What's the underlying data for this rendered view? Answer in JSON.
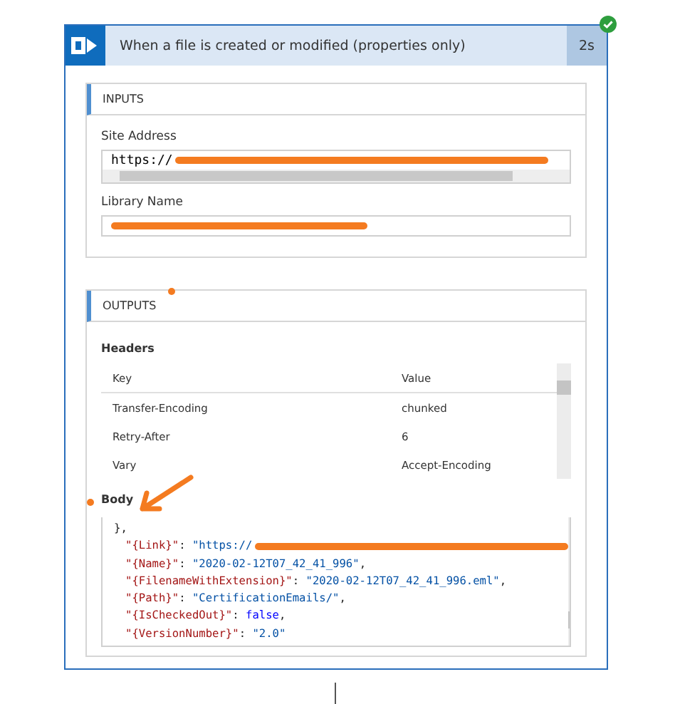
{
  "card": {
    "title": "When a file is created or modified (properties only)",
    "duration": "2s",
    "succeeded": true
  },
  "inputs": {
    "title": "INPUTS",
    "fields": [
      {
        "label": "Site Address",
        "value": "https://",
        "redacted": true,
        "scrollbar": true
      },
      {
        "label": "Library Name",
        "redacted": true,
        "scrollbar": false
      }
    ]
  },
  "outputs": {
    "title": "OUTPUTS",
    "headers": {
      "label": "Headers",
      "columns": [
        "Key",
        "Value"
      ],
      "rows": [
        {
          "key": "Transfer-Encoding",
          "value": "chunked"
        },
        {
          "key": "Retry-After",
          "value": "6"
        },
        {
          "key": "Vary",
          "value": "Accept-Encoding"
        }
      ]
    },
    "body": {
      "label": "Body",
      "lines": [
        {
          "parts": [
            {
              "t": "},",
              "kind": "punct"
            }
          ],
          "redacted": false
        },
        {
          "parts": [
            {
              "t": "\"{Link}\"",
              "kind": "key"
            },
            {
              "t": ": ",
              "kind": "punct"
            },
            {
              "t": "\"https://",
              "kind": "string"
            }
          ],
          "redacted": true
        },
        {
          "parts": [
            {
              "t": "\"{Name}\"",
              "kind": "key"
            },
            {
              "t": ": ",
              "kind": "punct"
            },
            {
              "t": "\"2020-02-12T07_42_41_996\"",
              "kind": "string"
            },
            {
              "t": ",",
              "kind": "punct"
            }
          ],
          "redacted": false
        },
        {
          "parts": [
            {
              "t": "\"{FilenameWithExtension}\"",
              "kind": "key"
            },
            {
              "t": ": ",
              "kind": "punct"
            },
            {
              "t": "\"2020-02-12T07_42_41_996.eml\"",
              "kind": "string"
            },
            {
              "t": ",",
              "kind": "punct"
            }
          ],
          "redacted": false
        },
        {
          "parts": [
            {
              "t": "\"{Path}\"",
              "kind": "key"
            },
            {
              "t": ": ",
              "kind": "punct"
            },
            {
              "t": "\"CertificationEmails/\"",
              "kind": "string"
            },
            {
              "t": ",",
              "kind": "punct"
            }
          ],
          "redacted": false
        },
        {
          "parts": [
            {
              "t": "\"{IsCheckedOut}\"",
              "kind": "key"
            },
            {
              "t": ": ",
              "kind": "punct"
            },
            {
              "t": "false",
              "kind": "literal"
            },
            {
              "t": ",",
              "kind": "punct"
            }
          ],
          "redacted": false
        },
        {
          "parts": [
            {
              "t": "\"{VersionNumber}\"",
              "kind": "key"
            },
            {
              "t": ": ",
              "kind": "punct"
            },
            {
              "t": "\"2.0\"",
              "kind": "string"
            }
          ],
          "redacted": false
        }
      ]
    }
  }
}
